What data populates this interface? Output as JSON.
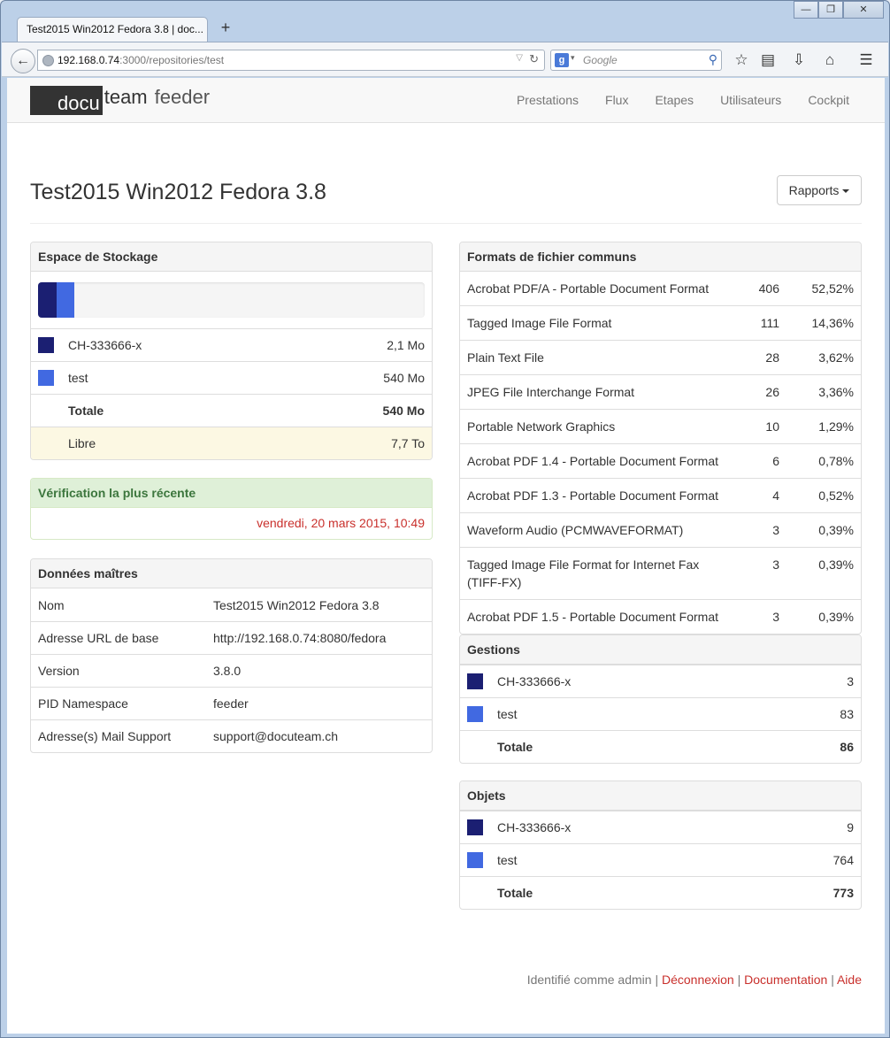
{
  "browser": {
    "tab_title": "Test2015 Win2012 Fedora 3.8 | doc...",
    "url_host": "192.168.0.74",
    "url_rest": ":3000/repositories/test",
    "search_placeholder": "Google"
  },
  "nav": {
    "brand_dark": "docu",
    "brand_rest": "team",
    "brand_suffix": "feeder",
    "links": [
      "Prestations",
      "Flux",
      "Etapes",
      "Utilisateurs",
      "Cockpit"
    ]
  },
  "page": {
    "title": "Test2015 Win2012 Fedora 3.8",
    "rapports_label": "Rapports"
  },
  "colors": {
    "series1": "#1b1f72",
    "series2": "#4169e1"
  },
  "storage": {
    "heading": "Espace de Stockage",
    "progress": [
      0.047,
      0.047
    ],
    "rows": [
      {
        "label": "CH-333666-x",
        "value": "2,1 Mo"
      },
      {
        "label": "test",
        "value": "540 Mo"
      }
    ],
    "total_label": "Totale",
    "total_value": "540 Mo",
    "free_label": "Libre",
    "free_value": "7,7 To"
  },
  "verification": {
    "heading": "Vérification la plus récente",
    "date": "vendredi, 20 mars 2015, 10:49"
  },
  "master": {
    "heading": "Données maîtres",
    "rows": [
      {
        "key": "Nom",
        "value": "Test2015 Win2012 Fedora 3.8"
      },
      {
        "key": "Adresse URL de base",
        "value": "http://192.168.0.74:8080/fedora"
      },
      {
        "key": "Version",
        "value": "3.8.0"
      },
      {
        "key": "PID Namespace",
        "value": "feeder"
      },
      {
        "key": "Adresse(s) Mail Support",
        "value": "support@docuteam.ch"
      }
    ]
  },
  "formats": {
    "heading": "Formats de fichier communs",
    "rows": [
      {
        "name": "Acrobat PDF/A - Portable Document Format",
        "count": "406",
        "pct": "52,52%"
      },
      {
        "name": "Tagged Image File Format",
        "count": "111",
        "pct": "14,36%"
      },
      {
        "name": "Plain Text File",
        "count": "28",
        "pct": "3,62%"
      },
      {
        "name": "JPEG File Interchange Format",
        "count": "26",
        "pct": "3,36%"
      },
      {
        "name": "Portable Network Graphics",
        "count": "10",
        "pct": "1,29%"
      },
      {
        "name": "Acrobat PDF 1.4 - Portable Document Format",
        "count": "6",
        "pct": "0,78%"
      },
      {
        "name": "Acrobat PDF 1.3 - Portable Document Format",
        "count": "4",
        "pct": "0,52%"
      },
      {
        "name": "Waveform Audio (PCMWAVEFORMAT)",
        "count": "3",
        "pct": "0,39%"
      },
      {
        "name": "Tagged Image File Format for Internet Fax (TIFF-FX)",
        "count": "3",
        "pct": "0,39%"
      },
      {
        "name": "Acrobat PDF 1.5 - Portable Document Format",
        "count": "3",
        "pct": "0,39%"
      }
    ]
  },
  "gestions": {
    "heading": "Gestions",
    "rows": [
      {
        "label": "CH-333666-x",
        "value": "3"
      },
      {
        "label": "test",
        "value": "83"
      }
    ],
    "total_label": "Totale",
    "total_value": "86"
  },
  "objets": {
    "heading": "Objets",
    "rows": [
      {
        "label": "CH-333666-x",
        "value": "9"
      },
      {
        "label": "test",
        "value": "764"
      }
    ],
    "total_label": "Totale",
    "total_value": "773"
  },
  "footer": {
    "identified": "Identifié comme admin",
    "sep": "|",
    "logout": "Déconnexion",
    "docs": "Documentation",
    "help": "Aide"
  }
}
